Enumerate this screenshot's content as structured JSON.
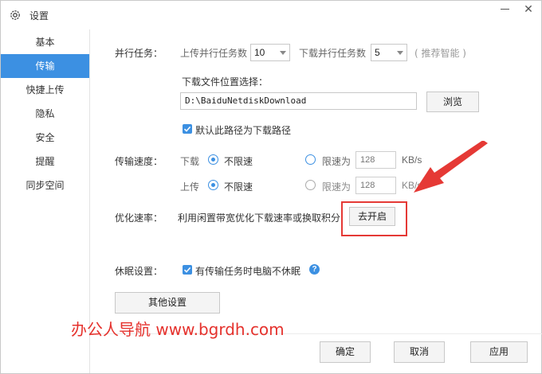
{
  "window": {
    "title": "设置"
  },
  "sidebar": {
    "items": [
      {
        "label": "基本"
      },
      {
        "label": "传输",
        "active": true
      },
      {
        "label": "快捷上传"
      },
      {
        "label": "隐私"
      },
      {
        "label": "安全"
      },
      {
        "label": "提醒"
      },
      {
        "label": "同步空间"
      }
    ]
  },
  "parallel": {
    "label": "并行任务：",
    "upload_label": "上传并行任务数",
    "upload_value": "10",
    "download_label": "下载并行任务数",
    "download_value": "5",
    "hint": "( 推荐智能 )"
  },
  "download_location": {
    "label": "下载文件位置选择：",
    "path": "D:\\BaiduNetdiskDownload",
    "browse_label": "浏览",
    "default_checkbox_label": "默认此路径为下载路径",
    "default_checked": true
  },
  "speed": {
    "label": "传输速度：",
    "download_label": "下载",
    "upload_label": "上传",
    "unlimited_label": "不限速",
    "limit_label": "限速为",
    "download_limit_value": "128",
    "upload_limit_value": "128",
    "unit": "KB/s"
  },
  "optimize": {
    "label": "优化速率：",
    "description": "利用闲置带宽优化下载速率或换取积分",
    "button_label": "去开启"
  },
  "sleep": {
    "label": "休眠设置：",
    "checkbox_label": "有传输任务时电脑不休眠",
    "checked": true
  },
  "other_settings_label": "其他设置",
  "footer": {
    "confirm_label": "确定",
    "cancel_label": "取消",
    "apply_label": "应用"
  },
  "watermark": "办公人导航  www.bgrdh.com",
  "colors": {
    "accent": "#3c90e2",
    "annotation_red": "#e53935"
  },
  "icons": {
    "title": "gear-icon",
    "minimize": "minimize-icon",
    "close": "close-icon",
    "help": "help-icon",
    "dropdown": "chevron-down-icon"
  }
}
